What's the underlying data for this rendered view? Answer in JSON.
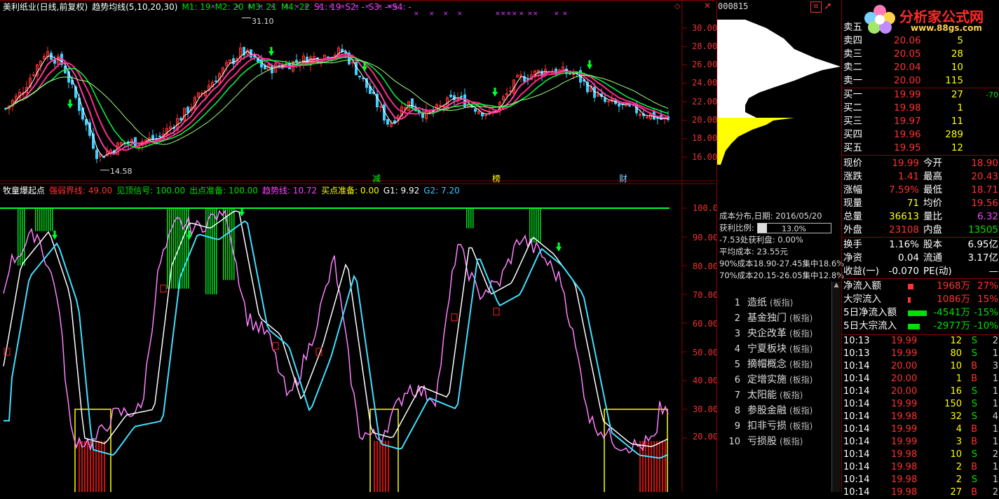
{
  "header": {
    "stock_name": "美利纸业(日线,前复权)",
    "indicator_name": "趋势均线(5,10,20,30)",
    "m1": "M1: 19",
    "m2": "M2: 20",
    "m3": "M3: 21",
    "m4": "M4: 22",
    "s1": "S1: 19",
    "s2": "S2: -",
    "s3": "S3: -",
    "s4": "S4: -"
  },
  "price_axis": [
    "30.00",
    "28.00",
    "26.00",
    "24.00",
    "22.00",
    "20.00",
    "18.00",
    "16.00"
  ],
  "price_annotations": {
    "high": "31.10",
    "low": "14.58"
  },
  "event_markers": [
    "减",
    "榜",
    "财"
  ],
  "indicator_header": {
    "name": "牧童爆起点",
    "weak_line": "强弱界线: 49.00",
    "top_signal": "见顶信号: 100.00",
    "exit_ready": "出点准备: 100.00",
    "trend_line": "趋势线: 10.72",
    "buy_ready": "买点准备: 0.00",
    "g1": "G1: 9.92",
    "g2": "G2: 7.20"
  },
  "indicator_axis": [
    "100.0",
    "90.00",
    "80.00",
    "70.00",
    "60.00",
    "50.00",
    "40.00",
    "30.00",
    "20.00"
  ],
  "side": {
    "code": "000815",
    "cost": {
      "title": "成本分布,日期: 2016/05/20",
      "profit_label": "获利比例:",
      "profit_value": "13.0%",
      "profit_fraction": 0.13,
      "line1": "-7.53处获利盘: 0.00%",
      "line2": "平均成本: 23.55元",
      "line3": "90%成本18.90-27.45集中18.6%",
      "line4": "70%成本20.15-26.05集中12.8%"
    },
    "sectors": [
      {
        "n": "1",
        "name": "造纸",
        "tag": "(板指)"
      },
      {
        "n": "2",
        "name": "基金独门",
        "tag": "(板指)"
      },
      {
        "n": "3",
        "name": "央企改革",
        "tag": "(板指)"
      },
      {
        "n": "4",
        "name": "宁夏板块",
        "tag": "(板指)"
      },
      {
        "n": "5",
        "name": "摘帽概念",
        "tag": "(板指)"
      },
      {
        "n": "6",
        "name": "定增实施",
        "tag": "(板指)"
      },
      {
        "n": "7",
        "name": "太阳能",
        "tag": "(板指)"
      },
      {
        "n": "8",
        "name": "参股金融",
        "tag": "(板指)"
      },
      {
        "n": "9",
        "name": "扣非亏损",
        "tag": "(板指)"
      },
      {
        "n": "10",
        "name": "亏损股",
        "tag": "(板指)"
      }
    ]
  },
  "logo": {
    "title": "分析家公式网",
    "url": "www.88gs.com"
  },
  "order_book": {
    "asks": [
      {
        "label": "卖五",
        "price": "",
        "vol": ""
      },
      {
        "label": "卖四",
        "price": "20.06",
        "vol": "5"
      },
      {
        "label": "卖三",
        "price": "20.05",
        "vol": "28"
      },
      {
        "label": "卖二",
        "price": "20.04",
        "vol": "10"
      },
      {
        "label": "卖一",
        "price": "20.00",
        "vol": "115"
      }
    ],
    "bids": [
      {
        "label": "买一",
        "price": "19.99",
        "vol": "27",
        "chg": "-70"
      },
      {
        "label": "买二",
        "price": "19.98",
        "vol": "1",
        "chg": ""
      },
      {
        "label": "买三",
        "price": "19.97",
        "vol": "11",
        "chg": ""
      },
      {
        "label": "买四",
        "price": "19.96",
        "vol": "289",
        "chg": ""
      },
      {
        "label": "买五",
        "price": "19.95",
        "vol": "12",
        "chg": ""
      }
    ]
  },
  "quote": [
    {
      "l1": "现价",
      "v1": "19.99",
      "c1": "red",
      "l2": "今开",
      "v2": "18.90",
      "c2": "red"
    },
    {
      "l1": "涨跌",
      "v1": "1.41",
      "c1": "red",
      "l2": "最高",
      "v2": "20.43",
      "c2": "red"
    },
    {
      "l1": "涨幅",
      "v1": "7.59%",
      "c1": "red",
      "l2": "最低",
      "v2": "18.71",
      "c2": "red"
    },
    {
      "l1": "现量",
      "v1": "71",
      "c1": "yel",
      "l2": "均价",
      "v2": "19.56",
      "c2": "red"
    },
    {
      "l1": "总量",
      "v1": "36613",
      "c1": "yel",
      "l2": "量比",
      "v2": "6.32",
      "c2": "mag"
    },
    {
      "l1": "外盘",
      "v1": "23108",
      "c1": "red",
      "l2": "内盘",
      "v2": "13505",
      "c2": "grn"
    }
  ],
  "fundamentals": [
    {
      "l1": "换手",
      "v1": "1.16%",
      "l2": "股本",
      "v2": "6.95亿"
    },
    {
      "l1": "净资",
      "v1": "0.04",
      "l2": "流通",
      "v2": "3.17亿"
    },
    {
      "l1": "收益(一)",
      "v1": "-0.070",
      "l2": "PE(动)",
      "v2": "—"
    }
  ],
  "flows": [
    {
      "label": "净流入额",
      "value": "1968万",
      "pct": "27%",
      "color": "#ff3232",
      "bar": 0.3
    },
    {
      "label": "大宗流入",
      "value": "1086万",
      "pct": "15%",
      "color": "#ff3232",
      "bar": 0.15
    },
    {
      "label": "5日净流入额",
      "value": "-4541万",
      "pct": "-15%",
      "color": "#00e000",
      "bar": 0.95
    },
    {
      "label": "5日大宗流入",
      "value": "-2977万",
      "pct": "-10%",
      "color": "#00e000",
      "bar": 0.6
    }
  ],
  "ticks": [
    {
      "t": "10:13",
      "p": "19.99",
      "v": "12",
      "d": "S",
      "n": "2"
    },
    {
      "t": "10:13",
      "p": "19.99",
      "v": "80",
      "d": "S",
      "n": "1"
    },
    {
      "t": "10:14",
      "p": "20.00",
      "v": "10",
      "d": "B",
      "n": "3"
    },
    {
      "t": "10:14",
      "p": "20.00",
      "v": "1",
      "d": "B",
      "n": "1"
    },
    {
      "t": "10:14",
      "p": "20.00",
      "v": "16",
      "d": "S",
      "n": "1"
    },
    {
      "t": "10:14",
      "p": "19.99",
      "v": "150",
      "d": "S",
      "n": "1"
    },
    {
      "t": "10:14",
      "p": "19.98",
      "v": "32",
      "d": "S",
      "n": "4"
    },
    {
      "t": "10:14",
      "p": "19.99",
      "v": "4",
      "d": "B",
      "n": "1"
    },
    {
      "t": "10:14",
      "p": "19.99",
      "v": "3",
      "d": "B",
      "n": "1"
    },
    {
      "t": "10:14",
      "p": "19.98",
      "v": "10",
      "d": "S",
      "n": "2"
    },
    {
      "t": "10:14",
      "p": "19.98",
      "v": "2",
      "d": "B",
      "n": "1"
    },
    {
      "t": "10:14",
      "p": "19.98",
      "v": "2",
      "d": "S",
      "n": "1"
    },
    {
      "t": "10:14",
      "p": "19.98",
      "v": "27",
      "d": "B",
      "n": "2"
    }
  ],
  "colors": {
    "up": "#ff3232",
    "down": "#00e000",
    "frame": "#880000",
    "ma5": "#ffffff",
    "ma10": "#ff3ca0",
    "ma20": "#00ff40",
    "ma30": "#a0ff80"
  }
}
